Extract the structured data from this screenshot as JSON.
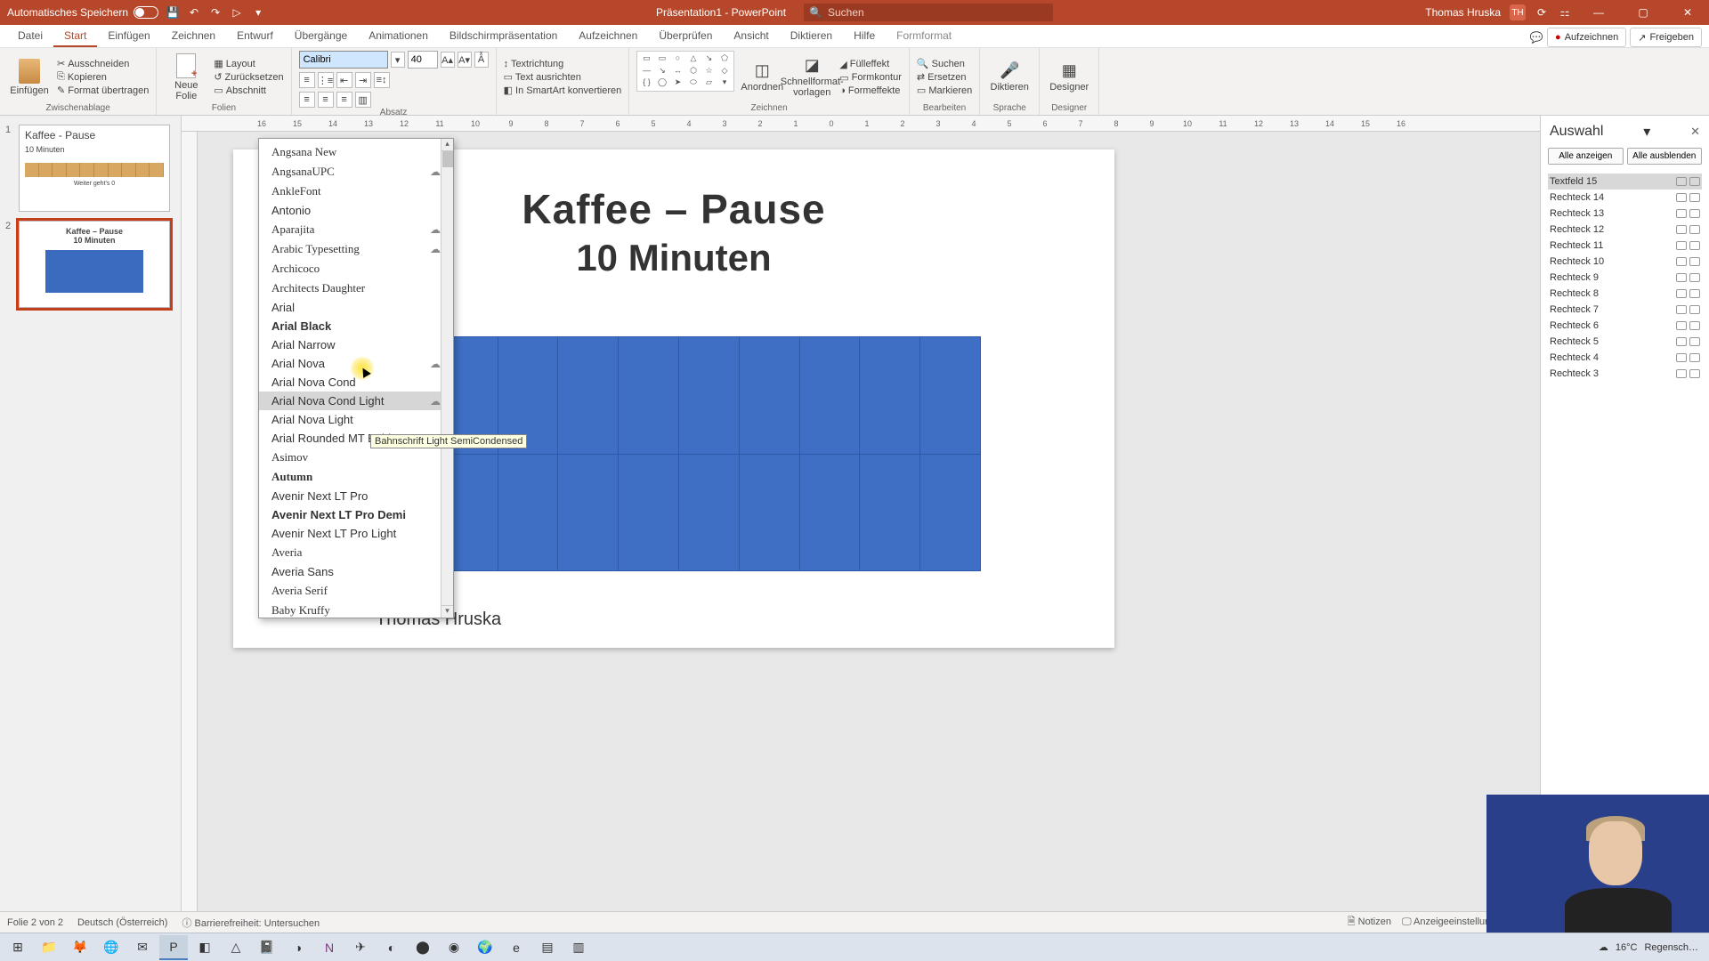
{
  "titlebar": {
    "autosave": "Automatisches Speichern",
    "doc_title": "Präsentation1 - PowerPoint",
    "search_placeholder": "Suchen",
    "user_name": "Thomas Hruska",
    "user_initials": "TH"
  },
  "tabs": {
    "items": [
      "Datei",
      "Start",
      "Einfügen",
      "Zeichnen",
      "Entwurf",
      "Übergänge",
      "Animationen",
      "Bildschirmpräsentation",
      "Aufzeichnen",
      "Überprüfen",
      "Ansicht",
      "Diktieren",
      "Hilfe",
      "Formformat"
    ],
    "active": "Start",
    "record": "Aufzeichnen",
    "share": "Freigeben"
  },
  "ribbon": {
    "clipboard": {
      "paste": "Einfügen",
      "cut": "Ausschneiden",
      "copy": "Kopieren",
      "format": "Format übertragen",
      "group": "Zwischenablage"
    },
    "slides": {
      "new": "Neue\nFolie",
      "layout": "Layout",
      "reset": "Zurücksetzen",
      "section": "Abschnitt",
      "group": "Folien"
    },
    "font": {
      "name": "Calibri",
      "size": "40"
    },
    "paragraph": {
      "dir": "Textrichtung",
      "align": "Text ausrichten",
      "smart": "In SmartArt konvertieren",
      "group": "Absatz"
    },
    "draw": {
      "arrange": "Anordnen",
      "quick": "Schnellformat-\nvorlagen",
      "fill": "Fülleffekt",
      "outline": "Formkontur",
      "effects": "Formeffekte",
      "group": "Zeichnen"
    },
    "edit": {
      "find": "Suchen",
      "replace": "Ersetzen",
      "select": "Markieren",
      "group": "Bearbeiten"
    },
    "voice": {
      "dictate": "Diktieren",
      "group": "Sprache"
    },
    "designer": {
      "label": "Designer",
      "group": "Designer"
    }
  },
  "ruler": [
    "16",
    "15",
    "14",
    "13",
    "12",
    "11",
    "10",
    "9",
    "8",
    "7",
    "6",
    "5",
    "4",
    "3",
    "2",
    "1",
    "0",
    "1",
    "2",
    "3",
    "4",
    "5",
    "6",
    "7",
    "8",
    "9",
    "10",
    "11",
    "12",
    "13",
    "14",
    "15",
    "16"
  ],
  "thumbs": {
    "1": {
      "title": "Kaffee - Pause",
      "sub": "10 Minuten",
      "bar": "Weiter geht's 0"
    },
    "2": {
      "title": "Kaffee – Pause",
      "sub": "10 Minuten"
    }
  },
  "slide": {
    "title": "Kaffee – Pause",
    "sub": "10 Minuten",
    "author": "Thomas Hruska"
  },
  "fontlist": {
    "items": [
      {
        "n": "Angsana New",
        "cloud": false
      },
      {
        "n": "AngsanaUPC",
        "cloud": true
      },
      {
        "n": "AnkleFont",
        "cloud": false
      },
      {
        "n": "Antonio",
        "cloud": false
      },
      {
        "n": "Aparajita",
        "cloud": true
      },
      {
        "n": "Arabic Typesetting",
        "cloud": true
      },
      {
        "n": "Archicoco",
        "cloud": false
      },
      {
        "n": "Architects Daughter",
        "cloud": false
      },
      {
        "n": "Arial",
        "cloud": false
      },
      {
        "n": "Arial Black",
        "cloud": false
      },
      {
        "n": "Arial Narrow",
        "cloud": false
      },
      {
        "n": "Arial Nova",
        "cloud": true
      },
      {
        "n": "Arial Nova Cond",
        "cloud": false
      },
      {
        "n": "Arial Nova Cond Light",
        "cloud": true,
        "hl": true
      },
      {
        "n": "Arial Nova Light",
        "cloud": false
      },
      {
        "n": "Arial Rounded MT Bold",
        "cloud": false
      },
      {
        "n": "Asimov",
        "cloud": false
      },
      {
        "n": "Autumn",
        "cloud": false
      },
      {
        "n": "Avenir Next LT Pro",
        "cloud": false
      },
      {
        "n": "Avenir Next LT Pro Demi",
        "cloud": false
      },
      {
        "n": "Avenir Next LT Pro Light",
        "cloud": false
      },
      {
        "n": "Averia",
        "cloud": false
      },
      {
        "n": "Averia Sans",
        "cloud": false
      },
      {
        "n": "Averia Serif",
        "cloud": false
      },
      {
        "n": "Baby Kruffy",
        "cloud": false
      }
    ],
    "tooltip": "Bahnschrift Light SemiCondensed"
  },
  "selection": {
    "title": "Auswahl",
    "show_all": "Alle anzeigen",
    "hide_all": "Alle ausblenden",
    "items": [
      "Textfeld 15",
      "Rechteck 14",
      "Rechteck 13",
      "Rechteck 12",
      "Rechteck 11",
      "Rechteck 10",
      "Rechteck 9",
      "Rechteck 8",
      "Rechteck 7",
      "Rechteck 6",
      "Rechteck 5",
      "Rechteck 4",
      "Rechteck 3"
    ],
    "selected": "Textfeld 15"
  },
  "status": {
    "slide": "Folie 2 von 2",
    "lang": "Deutsch (Österreich)",
    "access": "Barrierefreiheit: Untersuchen",
    "notes": "Notizen",
    "display": "Anzeigeeinstellungen"
  },
  "systray": {
    "temp": "16°C",
    "weather": "Regensch…"
  }
}
